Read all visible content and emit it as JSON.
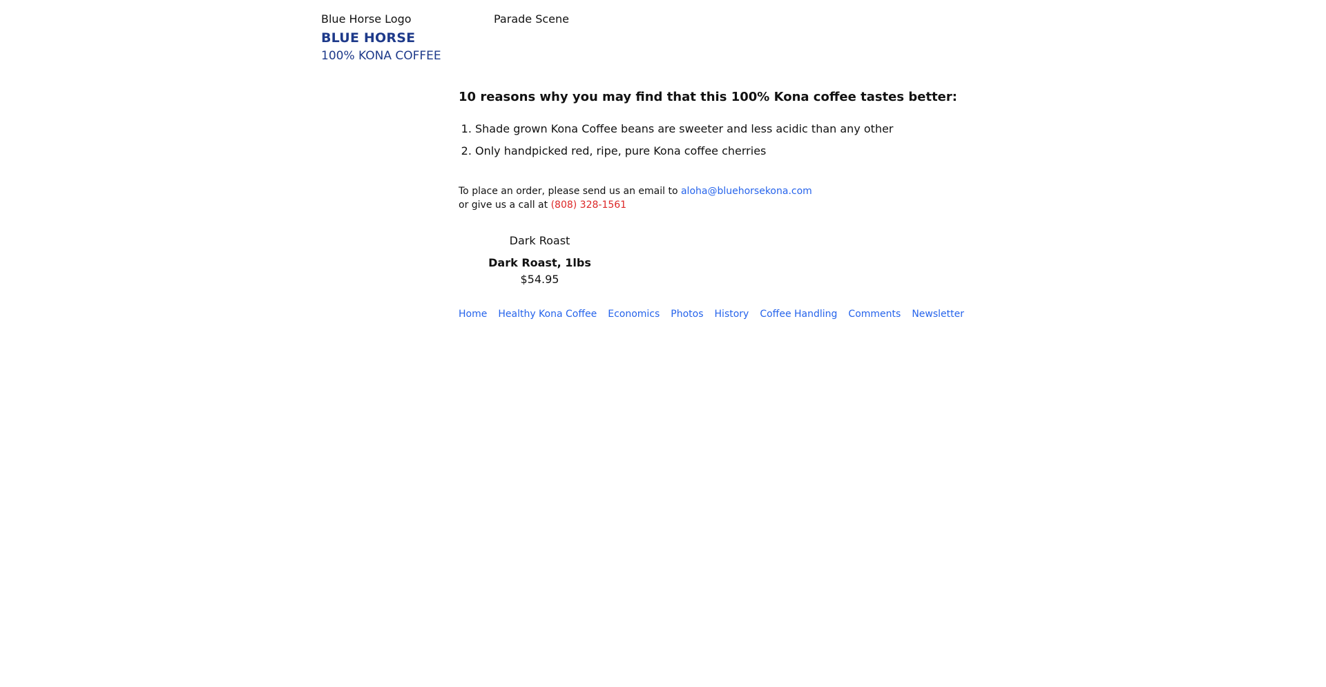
{
  "header": {
    "logo_alt": "Blue Horse Logo",
    "parade_alt": "Parade Scene",
    "brand_name": "BLUE HORSE",
    "brand_sub": "100% KONA COFFEE"
  },
  "main": {
    "heading": "10 reasons why you may find that this 100% Kona coffee tastes better:",
    "reasons": [
      "Shade grown Kona Coffee beans are sweeter and less acidic than any other",
      "Only handpicked red, ripe, pure Kona coffee cherries"
    ],
    "order": {
      "line1_prefix": "To place an order, please send us an email to",
      "email": "aloha@bluehorsekona.com",
      "line2_prefix": "or give us a call at",
      "phone": "(808) 328-1561"
    },
    "product": {
      "image_alt": "Dark Roast",
      "name": "Dark Roast, 1lbs",
      "price": "$54.95"
    }
  },
  "footer": {
    "nav": [
      "Home",
      "Healthy Kona Coffee",
      "Economics",
      "Photos",
      "History",
      "Coffee Handling",
      "Comments",
      "Newsletter"
    ]
  },
  "colors": {
    "brand": "#1e3a8a",
    "link": "#2563eb",
    "phone": "#dc2626"
  }
}
